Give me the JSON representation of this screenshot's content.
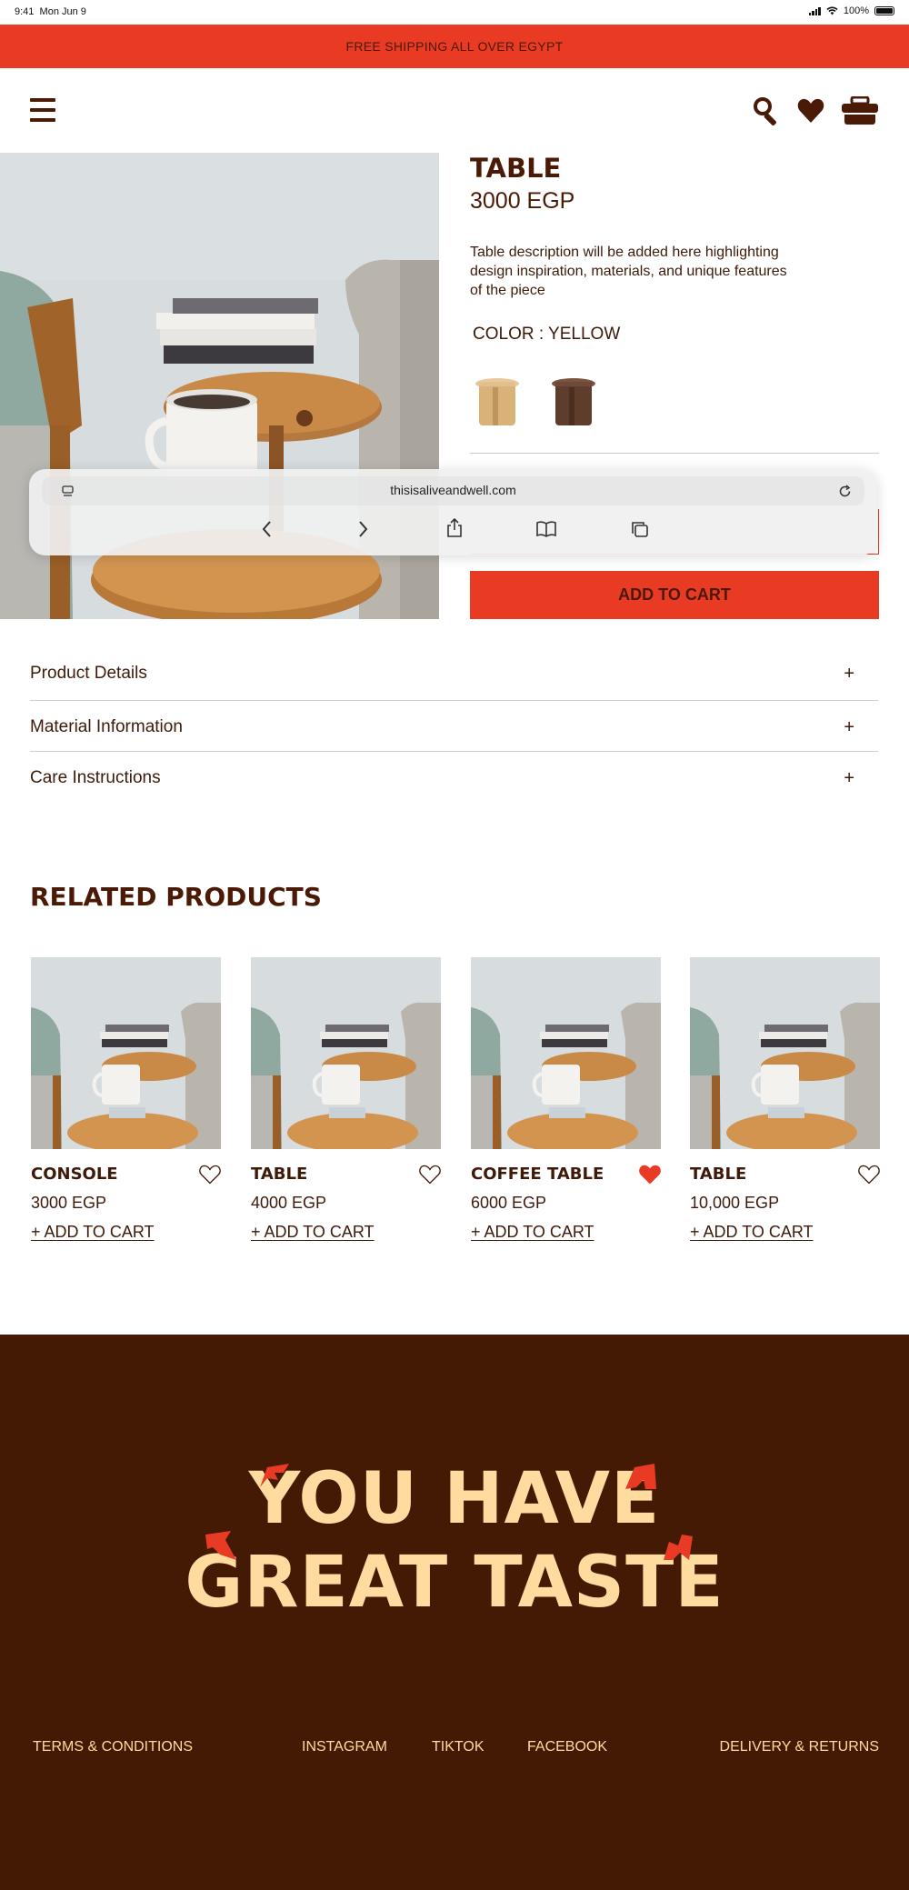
{
  "status_bar": {
    "time": "9:41",
    "date": "Mon Jun 9",
    "battery": "100%"
  },
  "banner": {
    "text": "FREE SHIPPING ALL OVER EGYPT"
  },
  "header": {
    "icons": [
      "menu-icon",
      "search-icon",
      "heart-icon",
      "cart-icon"
    ]
  },
  "product": {
    "title": "TABLE",
    "price": "3000 EGP",
    "description": "Table description will be added here highlighting design inspiration, materials, and unique features of the piece",
    "color_label": "COLOR : YELLOW",
    "swatches": [
      "yellow",
      "brown"
    ],
    "add_to_cart": "ADD TO CART"
  },
  "browser": {
    "url": "thisisaliveandwell.com"
  },
  "accordion": [
    {
      "label": "Product Details",
      "icon": "+"
    },
    {
      "label": "Material Information",
      "icon": "+"
    },
    {
      "label": "Care Instructions",
      "icon": "+"
    }
  ],
  "related": {
    "title": "RELATED PRODUCTS",
    "items": [
      {
        "name": "CONSOLE",
        "price": "3000 EGP",
        "cta": "+ ADD TO CART",
        "favorited": false
      },
      {
        "name": "TABLE",
        "price": "4000 EGP",
        "cta": "+ ADD TO CART",
        "favorited": false
      },
      {
        "name": "COFFEE TABLE",
        "price": "6000 EGP",
        "cta": "+ ADD TO CART",
        "favorited": true
      },
      {
        "name": "TABLE",
        "price": "10,000 EGP",
        "cta": "+ ADD TO CART",
        "favorited": false
      }
    ]
  },
  "footer": {
    "slogan_line1": "YOU HAVE",
    "slogan_line2": "GREAT TASTE",
    "links": {
      "terms": "TERMS & CONDITIONS",
      "instagram": "INSTAGRAM",
      "tiktok": "TIKTOK",
      "facebook": "FACEBOOK",
      "delivery": "DELIVERY & RETURNS"
    }
  },
  "colors": {
    "accent": "#e93b24",
    "brown": "#4a1a06",
    "footer_bg": "#451a04",
    "cream": "#fedc9f"
  }
}
